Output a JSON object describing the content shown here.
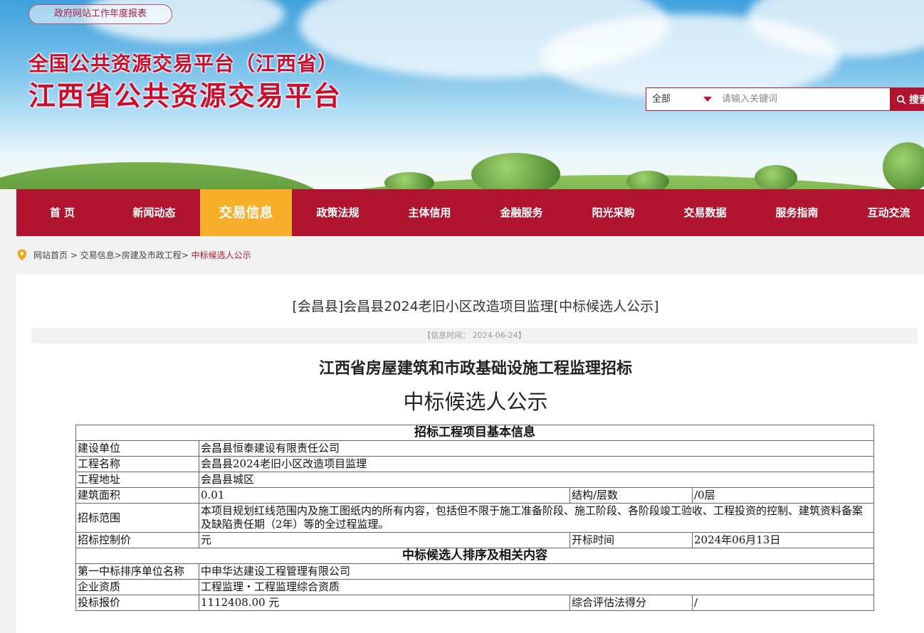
{
  "header": {
    "report_link": "政府网站工作年度报表",
    "logo_line1": "全国公共资源交易平台（江西省）",
    "logo_line2": "江西省公共资源交易平台"
  },
  "search": {
    "category": "全部",
    "placeholder": "请输入关键词",
    "button": "搜索",
    "icon": "search-icon"
  },
  "nav": [
    {
      "label": "首 页"
    },
    {
      "label": "新闻动态"
    },
    {
      "label": "交易信息"
    },
    {
      "label": "政策法规"
    },
    {
      "label": "主体信用"
    },
    {
      "label": "金融服务"
    },
    {
      "label": "阳光采购"
    },
    {
      "label": "交易数据"
    },
    {
      "label": "服务指南"
    },
    {
      "label": "互动交流"
    }
  ],
  "breadcrumb": {
    "icon": "location-pin-icon",
    "items": [
      "网站首页",
      "交易信息",
      "房建及市政工程"
    ],
    "current": "中标候选人公示"
  },
  "article": {
    "title": "[会昌县]会昌县2024老旧小区改造项目监理[中标候选人公示]",
    "info_time": "【信息时间： 2024-06-24】",
    "doc_title1": "江西省房屋建筑和市政基础设施工程监理招标",
    "doc_title2": "中标候选人公示"
  },
  "table": {
    "section1": "招标工程项目基本信息",
    "jianshe_label": "建设单位",
    "jianshe_value": "会昌县恒泰建设有限责任公司",
    "gcmc_label": "工程名称",
    "gcmc_value": "会昌县2024老旧小区改造项目监理",
    "gcdz_label": "工程地址",
    "gcdz_value": "会昌县城区",
    "area_label": "建筑面积",
    "area_value": "0.01",
    "struct_label": "结构/层数",
    "struct_value": "/0层",
    "scope_label": "招标范围",
    "scope_value": "本项目规划红线范围内及施工图纸内的所有内容，包括但不限于施工准备阶段、施工阶段、各阶段竣工验收、工程投资的控制、建筑资料备案及缺陷责任期（2年）等的全过程监理。",
    "price_label": "招标控制价",
    "price_value": "元",
    "open_label": "开标时间",
    "open_value": "2024年06月13日",
    "section2": "中标候选人排序及相关内容",
    "first_label": "第一中标排序单位名称",
    "first_value": "中申华达建设工程管理有限公司",
    "qual_label": "企业资质",
    "qual_value": "工程监理・工程监理综合资质",
    "bid_label": "投标报价",
    "bid_value": "1112408.00 元",
    "score_label": "综合评估法得分",
    "score_value": "/"
  }
}
